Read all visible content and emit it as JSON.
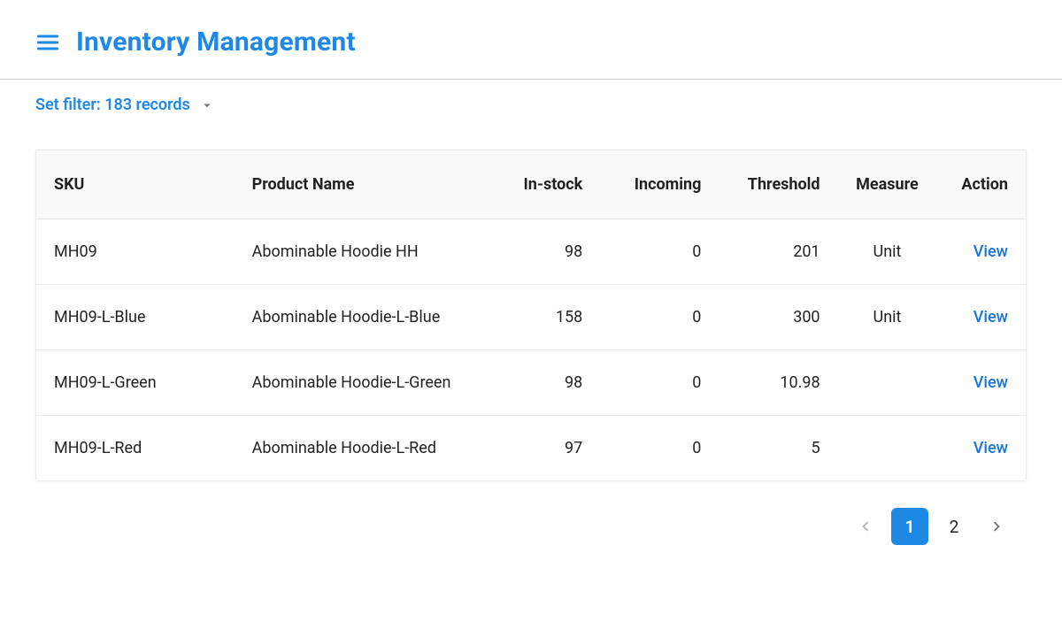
{
  "header": {
    "title": "Inventory Management"
  },
  "filter": {
    "label": "Set filter: 183 records"
  },
  "table": {
    "columns": {
      "sku": "SKU",
      "name": "Product Name",
      "in_stock": "In-stock",
      "incoming": "Incoming",
      "threshold": "Threshold",
      "measure": "Measure",
      "action": "Action"
    },
    "action_label": "View",
    "rows": [
      {
        "sku": "MH09",
        "name": "Abominable Hoodie HH",
        "in_stock": "98",
        "incoming": "0",
        "threshold": "201",
        "measure": "Unit"
      },
      {
        "sku": "MH09-L-Blue",
        "name": "Abominable Hoodie-L-Blue",
        "in_stock": "158",
        "incoming": "0",
        "threshold": "300",
        "measure": "Unit"
      },
      {
        "sku": "MH09-L-Green",
        "name": "Abominable Hoodie-L-Green",
        "in_stock": "98",
        "incoming": "0",
        "threshold": "10.98",
        "measure": ""
      },
      {
        "sku": "MH09-L-Red",
        "name": "Abominable Hoodie-L-Red",
        "in_stock": "97",
        "incoming": "0",
        "threshold": "5",
        "measure": ""
      }
    ]
  },
  "pagination": {
    "pages": [
      "1",
      "2"
    ],
    "active_index": 0
  }
}
